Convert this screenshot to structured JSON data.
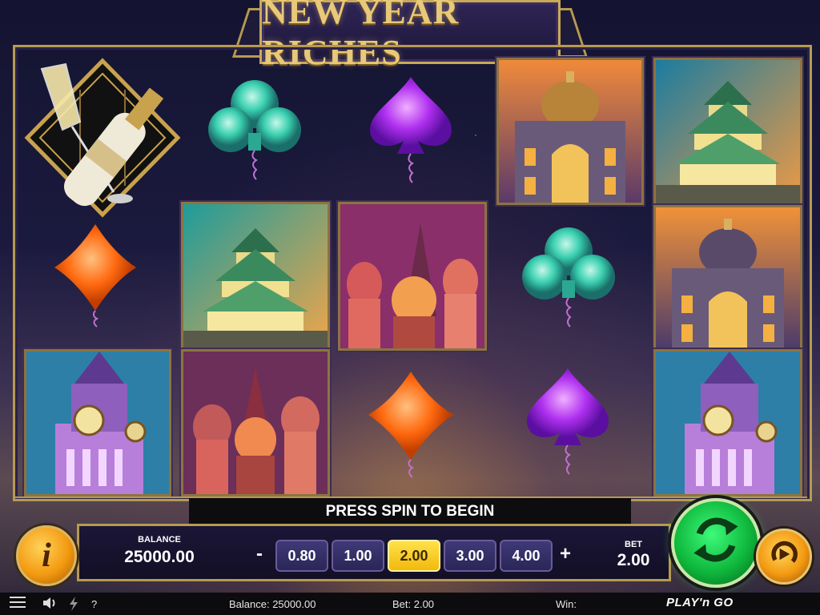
{
  "title": "NEW YEAR RICHES",
  "message": "PRESS SPIN TO BEGIN",
  "balance": {
    "label": "BALANCE",
    "value": "25000.00"
  },
  "bet": {
    "label": "BET",
    "value": "2.00",
    "decrease": "-",
    "increase": "+",
    "options": [
      "0.80",
      "1.00",
      "2.00",
      "3.00",
      "4.00"
    ],
    "selected_index": 2
  },
  "status_bar": {
    "balance": "Balance: 25000.00",
    "bet": "Bet: 2.00",
    "win": "Win:",
    "help": "?"
  },
  "provider": "PLAY'n GO",
  "info_glyph": "i",
  "icons": {
    "menu": "hamburger-menu-icon",
    "sound": "speaker-icon",
    "turbo": "lightning-icon",
    "spin": "spin-arrows-icon",
    "autoplay": "autoplay-icon"
  },
  "reels": [
    [
      "champagne",
      "diamond",
      "clock-tower"
    ],
    [
      "club",
      "castle",
      "cathedral"
    ],
    [
      "spade",
      "cathedral",
      "diamond"
    ],
    [
      "palace",
      "club",
      "spade"
    ],
    [
      "castle",
      "palace",
      "clock-tower"
    ]
  ],
  "colors": {
    "gold": "#b79a52",
    "club": "#3ad0b0",
    "spade": "#b030f0",
    "diamond": "#ff7a20",
    "spin": "#19c84a",
    "selected_chip": "#f5c518"
  }
}
